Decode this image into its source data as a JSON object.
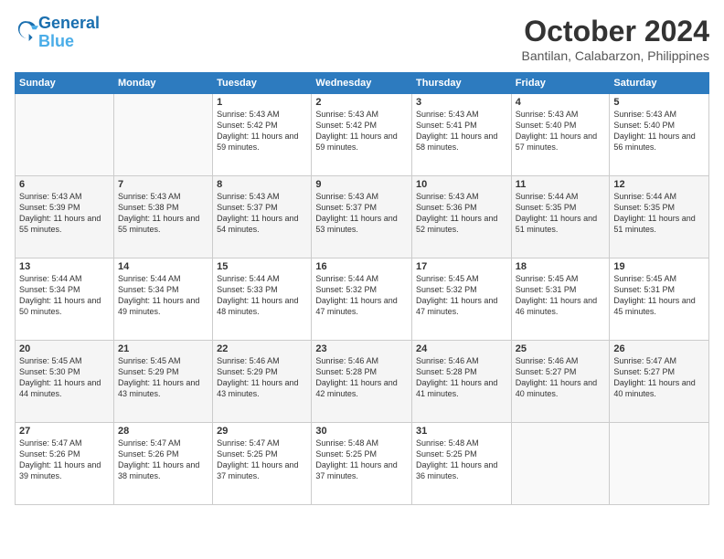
{
  "logo": {
    "line1": "General",
    "line2": "Blue"
  },
  "title": "October 2024",
  "location": "Bantilan, Calabarzon, Philippines",
  "weekdays": [
    "Sunday",
    "Monday",
    "Tuesday",
    "Wednesday",
    "Thursday",
    "Friday",
    "Saturday"
  ],
  "weeks": [
    [
      {
        "day": "",
        "info": ""
      },
      {
        "day": "",
        "info": ""
      },
      {
        "day": "1",
        "info": "Sunrise: 5:43 AM\nSunset: 5:42 PM\nDaylight: 11 hours and 59 minutes."
      },
      {
        "day": "2",
        "info": "Sunrise: 5:43 AM\nSunset: 5:42 PM\nDaylight: 11 hours and 59 minutes."
      },
      {
        "day": "3",
        "info": "Sunrise: 5:43 AM\nSunset: 5:41 PM\nDaylight: 11 hours and 58 minutes."
      },
      {
        "day": "4",
        "info": "Sunrise: 5:43 AM\nSunset: 5:40 PM\nDaylight: 11 hours and 57 minutes."
      },
      {
        "day": "5",
        "info": "Sunrise: 5:43 AM\nSunset: 5:40 PM\nDaylight: 11 hours and 56 minutes."
      }
    ],
    [
      {
        "day": "6",
        "info": "Sunrise: 5:43 AM\nSunset: 5:39 PM\nDaylight: 11 hours and 55 minutes."
      },
      {
        "day": "7",
        "info": "Sunrise: 5:43 AM\nSunset: 5:38 PM\nDaylight: 11 hours and 55 minutes."
      },
      {
        "day": "8",
        "info": "Sunrise: 5:43 AM\nSunset: 5:37 PM\nDaylight: 11 hours and 54 minutes."
      },
      {
        "day": "9",
        "info": "Sunrise: 5:43 AM\nSunset: 5:37 PM\nDaylight: 11 hours and 53 minutes."
      },
      {
        "day": "10",
        "info": "Sunrise: 5:43 AM\nSunset: 5:36 PM\nDaylight: 11 hours and 52 minutes."
      },
      {
        "day": "11",
        "info": "Sunrise: 5:44 AM\nSunset: 5:35 PM\nDaylight: 11 hours and 51 minutes."
      },
      {
        "day": "12",
        "info": "Sunrise: 5:44 AM\nSunset: 5:35 PM\nDaylight: 11 hours and 51 minutes."
      }
    ],
    [
      {
        "day": "13",
        "info": "Sunrise: 5:44 AM\nSunset: 5:34 PM\nDaylight: 11 hours and 50 minutes."
      },
      {
        "day": "14",
        "info": "Sunrise: 5:44 AM\nSunset: 5:34 PM\nDaylight: 11 hours and 49 minutes."
      },
      {
        "day": "15",
        "info": "Sunrise: 5:44 AM\nSunset: 5:33 PM\nDaylight: 11 hours and 48 minutes."
      },
      {
        "day": "16",
        "info": "Sunrise: 5:44 AM\nSunset: 5:32 PM\nDaylight: 11 hours and 47 minutes."
      },
      {
        "day": "17",
        "info": "Sunrise: 5:45 AM\nSunset: 5:32 PM\nDaylight: 11 hours and 47 minutes."
      },
      {
        "day": "18",
        "info": "Sunrise: 5:45 AM\nSunset: 5:31 PM\nDaylight: 11 hours and 46 minutes."
      },
      {
        "day": "19",
        "info": "Sunrise: 5:45 AM\nSunset: 5:31 PM\nDaylight: 11 hours and 45 minutes."
      }
    ],
    [
      {
        "day": "20",
        "info": "Sunrise: 5:45 AM\nSunset: 5:30 PM\nDaylight: 11 hours and 44 minutes."
      },
      {
        "day": "21",
        "info": "Sunrise: 5:45 AM\nSunset: 5:29 PM\nDaylight: 11 hours and 43 minutes."
      },
      {
        "day": "22",
        "info": "Sunrise: 5:46 AM\nSunset: 5:29 PM\nDaylight: 11 hours and 43 minutes."
      },
      {
        "day": "23",
        "info": "Sunrise: 5:46 AM\nSunset: 5:28 PM\nDaylight: 11 hours and 42 minutes."
      },
      {
        "day": "24",
        "info": "Sunrise: 5:46 AM\nSunset: 5:28 PM\nDaylight: 11 hours and 41 minutes."
      },
      {
        "day": "25",
        "info": "Sunrise: 5:46 AM\nSunset: 5:27 PM\nDaylight: 11 hours and 40 minutes."
      },
      {
        "day": "26",
        "info": "Sunrise: 5:47 AM\nSunset: 5:27 PM\nDaylight: 11 hours and 40 minutes."
      }
    ],
    [
      {
        "day": "27",
        "info": "Sunrise: 5:47 AM\nSunset: 5:26 PM\nDaylight: 11 hours and 39 minutes."
      },
      {
        "day": "28",
        "info": "Sunrise: 5:47 AM\nSunset: 5:26 PM\nDaylight: 11 hours and 38 minutes."
      },
      {
        "day": "29",
        "info": "Sunrise: 5:47 AM\nSunset: 5:25 PM\nDaylight: 11 hours and 37 minutes."
      },
      {
        "day": "30",
        "info": "Sunrise: 5:48 AM\nSunset: 5:25 PM\nDaylight: 11 hours and 37 minutes."
      },
      {
        "day": "31",
        "info": "Sunrise: 5:48 AM\nSunset: 5:25 PM\nDaylight: 11 hours and 36 minutes."
      },
      {
        "day": "",
        "info": ""
      },
      {
        "day": "",
        "info": ""
      }
    ]
  ]
}
